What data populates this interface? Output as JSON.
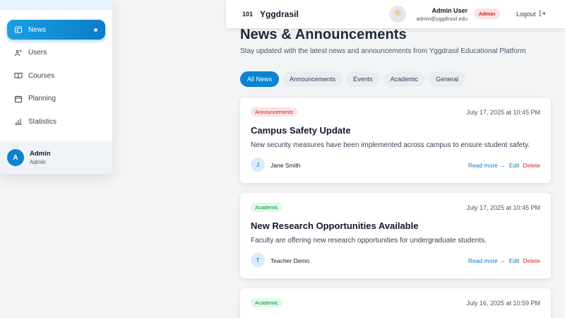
{
  "sidebar": {
    "items": [
      {
        "label": "News",
        "icon": "newspaper-icon",
        "active": true
      },
      {
        "label": "Users",
        "icon": "users-icon"
      },
      {
        "label": "Courses",
        "icon": "book-icon"
      },
      {
        "label": "Planning",
        "icon": "calendar-icon"
      },
      {
        "label": "Statistics",
        "icon": "bar-chart-icon"
      }
    ],
    "user": {
      "initial": "A",
      "name": "Admin",
      "role": "Admin"
    }
  },
  "header": {
    "logo_number": "101",
    "logo_text": "Yggdrasil",
    "theme_icon": "sun-icon",
    "user_name": "Admin User",
    "user_email": "admin@yggdrasil.edu",
    "role_badge": "Admin",
    "logout_label": "Logout"
  },
  "page": {
    "title": "News & Announcements",
    "subtitle": "Stay updated with the latest news and announcements from Yggdrasil Educational Platform"
  },
  "filters": [
    "All News",
    "Announcements",
    "Events",
    "Academic",
    "General"
  ],
  "active_filter": "All News",
  "news": [
    {
      "category": "Announcements",
      "date": "July 17, 2025 at 10:45 PM",
      "title": "Campus Safety Update",
      "description": "New security measures have been implemented across campus to ensure student safety.",
      "author_initial": "J",
      "author": "Jane Smith"
    },
    {
      "category": "Academic",
      "date": "July 17, 2025 at 10:45 PM",
      "title": "New Research Opportunities Available",
      "description": "Faculty are offering new research opportunities for undergraduate students.",
      "author_initial": "T",
      "author": "Teacher Demo"
    },
    {
      "category": "Academic",
      "date": "July 16, 2025 at 10:59 PM",
      "title": "",
      "description": "",
      "author_initial": "",
      "author": ""
    }
  ],
  "actions": {
    "read_more": "Read more →",
    "edit": "Edit",
    "delete": "Delete"
  },
  "colors": {
    "primary": "#0a83d1",
    "tag_announcements_bg": "#fde2e2",
    "tag_announcements_fg": "#c0262d",
    "tag_academic_bg": "#dcfce7",
    "tag_academic_fg": "#15803d",
    "delete": "#dc2626"
  }
}
